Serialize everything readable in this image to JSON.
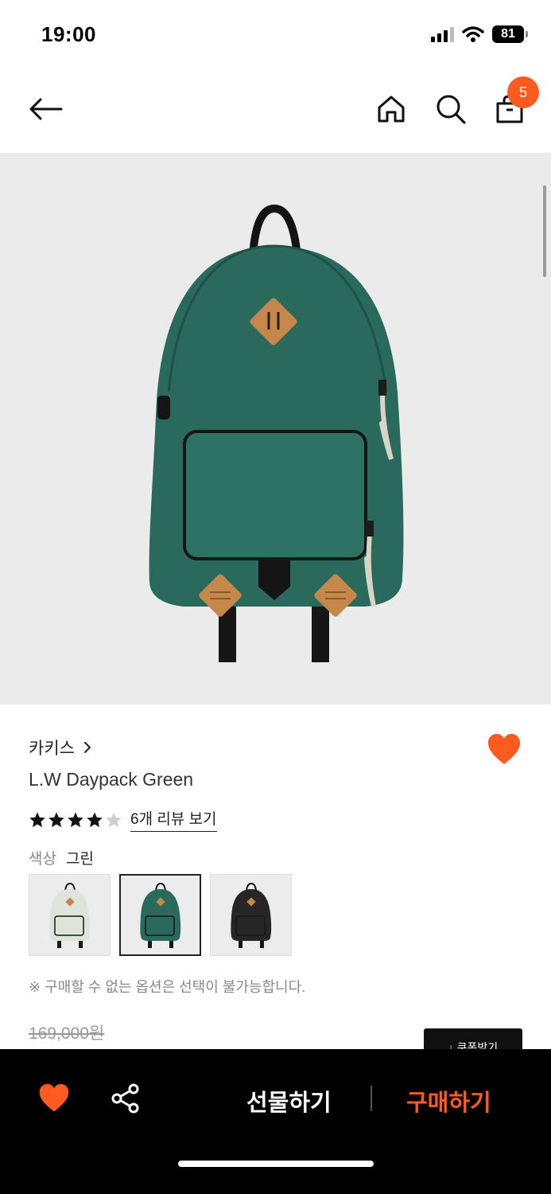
{
  "status_bar": {
    "time": "19:00",
    "battery": "81"
  },
  "nav": {
    "cart_count": "5"
  },
  "product": {
    "brand": "카키스",
    "name": "L.W Daypack Green",
    "rating": 4,
    "rating_max": 5,
    "review_link": "6개 리뷰 보기",
    "color_label": "색상",
    "color_value": "그린",
    "swatches": [
      {
        "color": "#dfe4da",
        "label": "mint"
      },
      {
        "color": "#2a6a5c",
        "label": "green"
      },
      {
        "color": "#262626",
        "label": "black"
      }
    ],
    "option_note": "※ 구매할 수 없는 옵션은 선택이 불가능합니다.",
    "original_price": "169,000원",
    "coupon_label": "↓ 쿠폰받기"
  },
  "bottom_bar": {
    "gift_label": "선물하기",
    "buy_label": "구매하기"
  },
  "colors": {
    "accent": "#ff5a1f",
    "bag_green": "#2a6a5c",
    "image_bg": "#ebebeb"
  }
}
